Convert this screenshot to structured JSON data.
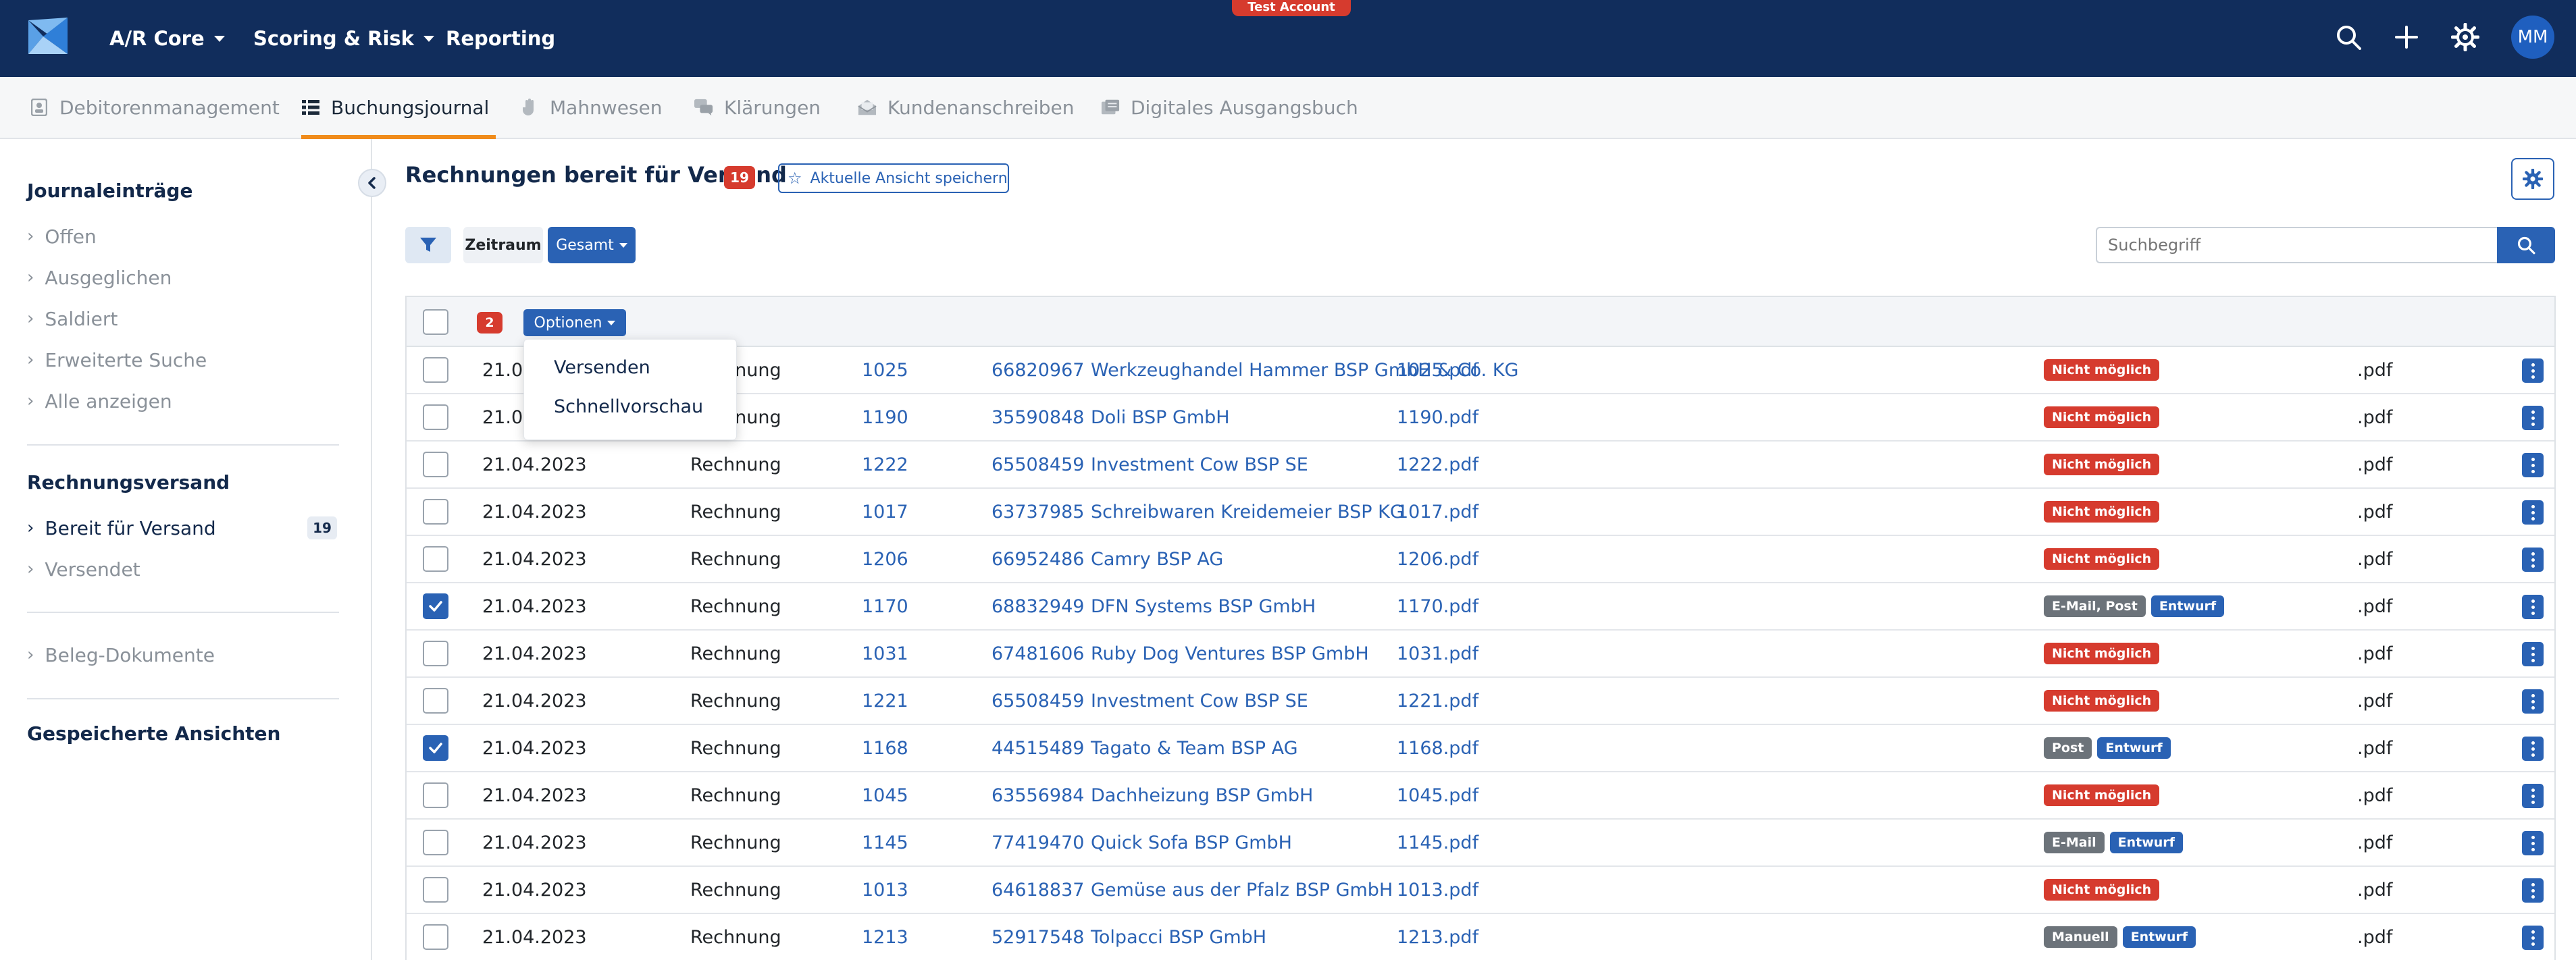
{
  "topnav": {
    "menus": [
      {
        "label": "A/R Core"
      },
      {
        "label": "Scoring & Risk"
      },
      {
        "label": "Reporting"
      }
    ],
    "test_badge": "Test Account",
    "avatar_initials": "MM",
    "icons": [
      "search-icon",
      "plus-icon",
      "gear-icon"
    ]
  },
  "subnav": {
    "tabs": [
      {
        "label": "Debitorenmanagement",
        "icon": "person-card-icon"
      },
      {
        "label": "Buchungsjournal",
        "icon": "list-icon",
        "active": true
      },
      {
        "label": "Mahnwesen",
        "icon": "hand-icon"
      },
      {
        "label": "Klärungen",
        "icon": "chat-icon"
      },
      {
        "label": "Kundenanschreiben",
        "icon": "mail-icon"
      },
      {
        "label": "Digitales Ausgangsbuch",
        "icon": "book-icon"
      }
    ]
  },
  "sidebar": {
    "journal_heading": "Journaleinträge",
    "journal_items": [
      {
        "label": "Offen"
      },
      {
        "label": "Ausgeglichen"
      },
      {
        "label": "Saldiert"
      },
      {
        "label": "Erweiterte Suche"
      },
      {
        "label": "Alle anzeigen"
      }
    ],
    "versand_heading": "Rechnungsversand",
    "versand_items": [
      {
        "label": "Bereit für Versand",
        "count": "19",
        "active": true
      },
      {
        "label": "Versendet"
      }
    ],
    "beleg_item": "Beleg-Dokumente",
    "saved_heading": "Gespeicherte Ansichten"
  },
  "main": {
    "title": "Rechnungen bereit für Versand",
    "title_count": "19",
    "save_view_label": "Aktuelle Ansicht speichern",
    "filter": {
      "zeitraum_label": "Zeitraum",
      "gesamt_label": "Gesamt"
    },
    "search_placeholder": "Suchbegriff"
  },
  "table": {
    "selected_count": "2",
    "options_label": "Optionen",
    "dropdown": [
      "Versenden",
      "Schnellvorschau"
    ],
    "rows": [
      {
        "date": "21.04.2023",
        "type": "Rechnung",
        "nr": "1025",
        "customer_nr": "66820967",
        "customer": "Werkzeughandel Hammer BSP GmbH & Co. KG",
        "file": "1025.pdf",
        "status": [
          {
            "text": "Nicht möglich",
            "color": "red"
          }
        ],
        "ext": ".pdf",
        "checked": false
      },
      {
        "date": "21.04.2023",
        "type": "Rechnung",
        "nr": "1190",
        "customer_nr": "35590848",
        "customer": "Doli BSP GmbH",
        "file": "1190.pdf",
        "status": [
          {
            "text": "Nicht möglich",
            "color": "red"
          }
        ],
        "ext": ".pdf",
        "checked": false
      },
      {
        "date": "21.04.2023",
        "type": "Rechnung",
        "nr": "1222",
        "customer_nr": "65508459",
        "customer": "Investment Cow BSP SE",
        "file": "1222.pdf",
        "status": [
          {
            "text": "Nicht möglich",
            "color": "red"
          }
        ],
        "ext": ".pdf",
        "checked": false
      },
      {
        "date": "21.04.2023",
        "type": "Rechnung",
        "nr": "1017",
        "customer_nr": "63737985",
        "customer": "Schreibwaren Kreidemeier BSP KG",
        "file": "1017.pdf",
        "status": [
          {
            "text": "Nicht möglich",
            "color": "red"
          }
        ],
        "ext": ".pdf",
        "checked": false
      },
      {
        "date": "21.04.2023",
        "type": "Rechnung",
        "nr": "1206",
        "customer_nr": "66952486",
        "customer": "Camry BSP AG",
        "file": "1206.pdf",
        "status": [
          {
            "text": "Nicht möglich",
            "color": "red"
          }
        ],
        "ext": ".pdf",
        "checked": false
      },
      {
        "date": "21.04.2023",
        "type": "Rechnung",
        "nr": "1170",
        "customer_nr": "68832949",
        "customer": "DFN Systems BSP GmbH",
        "file": "1170.pdf",
        "status": [
          {
            "text": "E-Mail, Post",
            "color": "gray"
          },
          {
            "text": "Entwurf",
            "color": "blue"
          }
        ],
        "ext": ".pdf",
        "checked": true
      },
      {
        "date": "21.04.2023",
        "type": "Rechnung",
        "nr": "1031",
        "customer_nr": "67481606",
        "customer": "Ruby Dog Ventures BSP GmbH",
        "file": "1031.pdf",
        "status": [
          {
            "text": "Nicht möglich",
            "color": "red"
          }
        ],
        "ext": ".pdf",
        "checked": false
      },
      {
        "date": "21.04.2023",
        "type": "Rechnung",
        "nr": "1221",
        "customer_nr": "65508459",
        "customer": "Investment Cow BSP SE",
        "file": "1221.pdf",
        "status": [
          {
            "text": "Nicht möglich",
            "color": "red"
          }
        ],
        "ext": ".pdf",
        "checked": false
      },
      {
        "date": "21.04.2023",
        "type": "Rechnung",
        "nr": "1168",
        "customer_nr": "44515489",
        "customer": "Tagato & Team BSP AG",
        "file": "1168.pdf",
        "status": [
          {
            "text": "Post",
            "color": "gray"
          },
          {
            "text": "Entwurf",
            "color": "blue"
          }
        ],
        "ext": ".pdf",
        "checked": true
      },
      {
        "date": "21.04.2023",
        "type": "Rechnung",
        "nr": "1045",
        "customer_nr": "63556984",
        "customer": "Dachheizung BSP GmbH",
        "file": "1045.pdf",
        "status": [
          {
            "text": "Nicht möglich",
            "color": "red"
          }
        ],
        "ext": ".pdf",
        "checked": false
      },
      {
        "date": "21.04.2023",
        "type": "Rechnung",
        "nr": "1145",
        "customer_nr": "77419470",
        "customer": "Quick Sofa BSP GmbH",
        "file": "1145.pdf",
        "status": [
          {
            "text": "E-Mail",
            "color": "gray"
          },
          {
            "text": "Entwurf",
            "color": "blue"
          }
        ],
        "ext": ".pdf",
        "checked": false
      },
      {
        "date": "21.04.2023",
        "type": "Rechnung",
        "nr": "1013",
        "customer_nr": "64618837",
        "customer": "Gemüse aus der Pfalz BSP GmbH",
        "file": "1013.pdf",
        "status": [
          {
            "text": "Nicht möglich",
            "color": "red"
          }
        ],
        "ext": ".pdf",
        "checked": false
      },
      {
        "date": "21.04.2023",
        "type": "Rechnung",
        "nr": "1213",
        "customer_nr": "52917548",
        "customer": "Tolpacci BSP GmbH",
        "file": "1213.pdf",
        "status": [
          {
            "text": "Manuell",
            "color": "gray"
          },
          {
            "text": "Entwurf",
            "color": "blue"
          }
        ],
        "ext": ".pdf",
        "checked": false
      }
    ]
  },
  "colors": {
    "nav_bg": "#112d5c",
    "accent": "#2a62b4",
    "danger": "#d63b2e",
    "tab_underline": "#f08c1c",
    "gray_badge": "#6c737a"
  }
}
